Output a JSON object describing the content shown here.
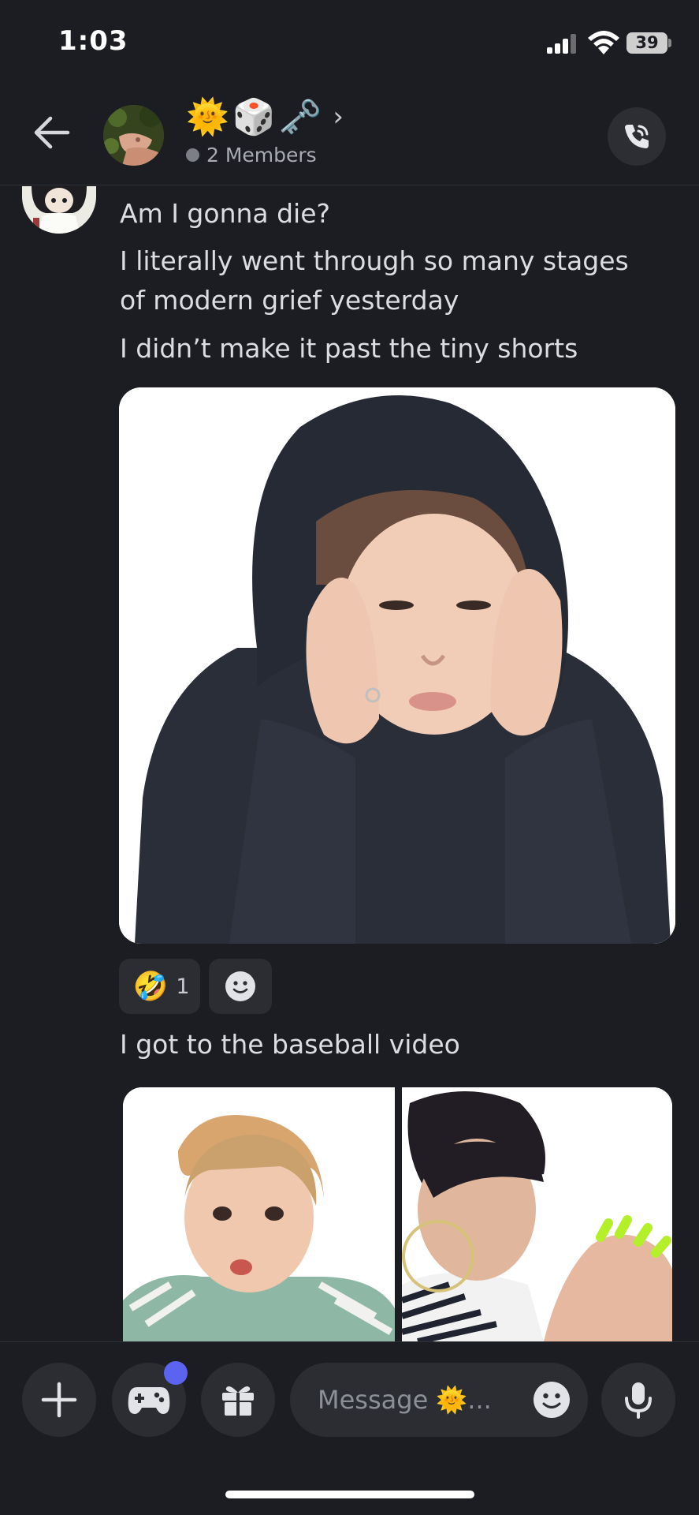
{
  "status_bar": {
    "time": "1:03",
    "battery": "39"
  },
  "header": {
    "title_emojis": [
      "🌞",
      "🎲",
      "🗝️"
    ],
    "members": "2 Members",
    "icons": {
      "back": "arrow-left-icon",
      "call": "phone-call-icon",
      "chevron": "chevron-right-icon"
    }
  },
  "messages": [
    {
      "text": "Am I gonna die?"
    },
    {
      "text": "I literally went through so many stages of modern grief yesterday"
    },
    {
      "text": "I didn’t make it past the tiny shorts"
    },
    {
      "text": "I got to the baseball video"
    }
  ],
  "reactions": [
    {
      "emoji": "🤣",
      "count": "1"
    }
  ],
  "composer": {
    "placeholder": "Message 🌞..."
  },
  "colors": {
    "background": "#1c1d22",
    "surface": "#2b2d33",
    "text": "#dcdde1",
    "muted": "#a9abb3",
    "notification": "#5b63f1"
  }
}
